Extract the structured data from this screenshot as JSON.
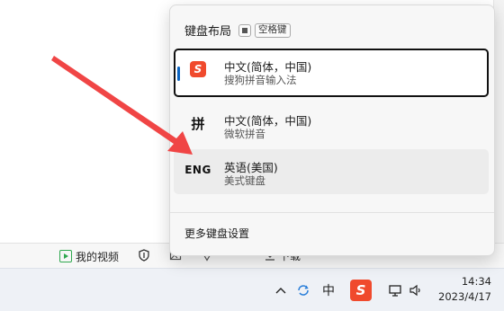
{
  "statusbar": {
    "video_label": "我的视频",
    "download_label": "下载"
  },
  "popup": {
    "title": "键盘布局",
    "shortcut_key": "空格键",
    "items": [
      {
        "name": "中文(简体，中国)",
        "desc": "搜狗拼音输入法",
        "icon": "sogou-logo"
      },
      {
        "name": "中文(简体，中国)",
        "desc": "微软拼音",
        "icon_text": "拼"
      },
      {
        "name": "英语(美国)",
        "desc": "美式键盘",
        "icon_text": "ENG"
      }
    ],
    "more_settings": "更多键盘设置"
  },
  "taskbar": {
    "ime_char": "中",
    "sogou_char": "S",
    "time": "14:34",
    "date": "2023/4/17"
  },
  "colors": {
    "arrow": "#f04545",
    "accent": "#0a64c2",
    "sogou": "#f04a2d"
  }
}
